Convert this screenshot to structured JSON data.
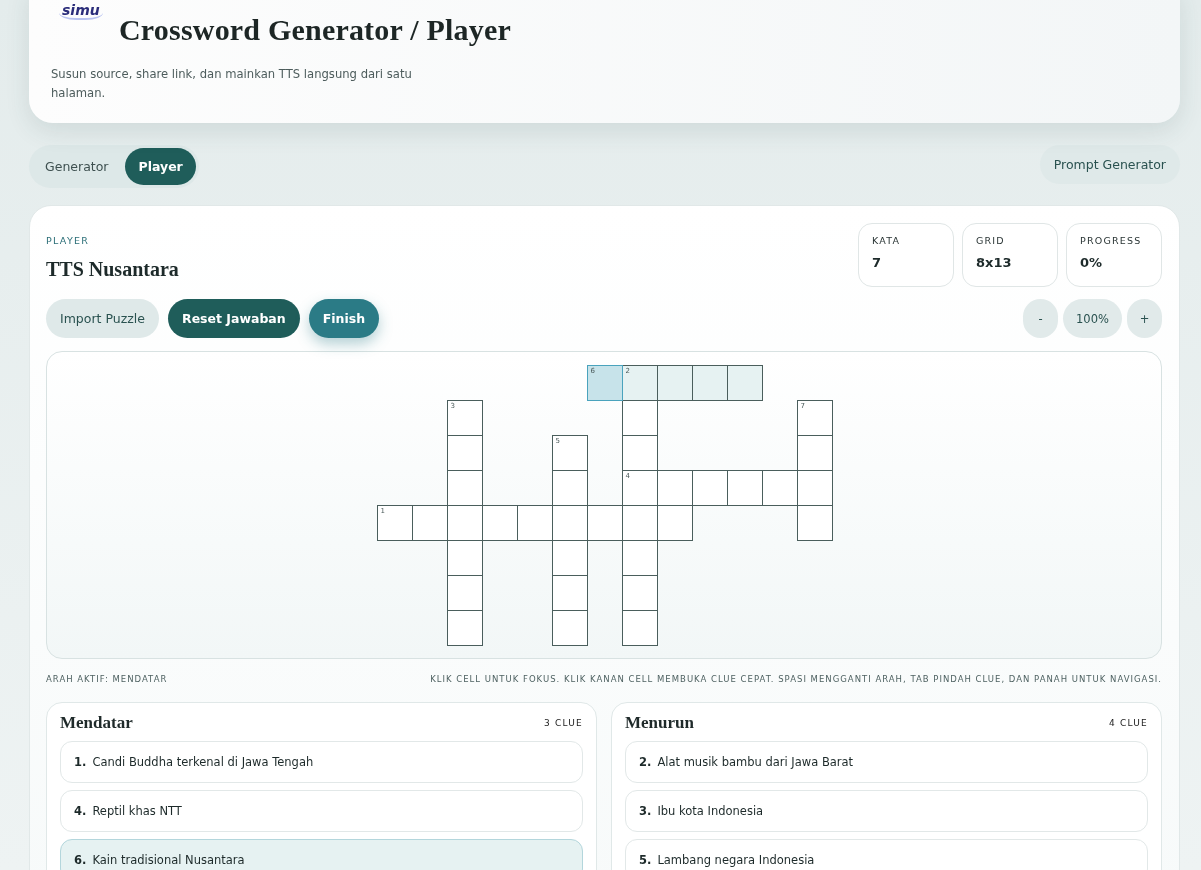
{
  "header": {
    "logo": "simu",
    "title": "Crossword Generator / Player",
    "subtitle": "Susun source, share link, dan mainkan TTS langsung dari satu halaman."
  },
  "mode_tabs": [
    {
      "label": "Generator",
      "selected": false
    },
    {
      "label": "Player",
      "selected": true
    }
  ],
  "prompt_button": "Prompt Generator",
  "player": {
    "eyebrow": "PLAYER",
    "title": "TTS Nusantara",
    "stats": [
      {
        "label": "KATA",
        "value": "7"
      },
      {
        "label": "GRID",
        "value": "8x13"
      },
      {
        "label": "PROGRESS",
        "value": "0%"
      }
    ],
    "actions": [
      {
        "label": "Import Puzzle",
        "kind": "light"
      },
      {
        "label": "Reset Jawaban",
        "kind": "dark"
      },
      {
        "label": "Finish",
        "kind": "accent"
      }
    ],
    "zoom": {
      "minus": "-",
      "value": "100%",
      "plus": "+"
    },
    "grid": {
      "rows": [
        {
          "cells": [
            {
              "kind": "block"
            },
            {
              "kind": "block"
            },
            {
              "kind": "block"
            },
            {
              "kind": "block"
            },
            {
              "kind": "block"
            },
            {
              "kind": "block"
            },
            {
              "kind": "cell",
              "number": "6",
              "focused": true,
              "highlighted": true
            },
            {
              "kind": "cell",
              "number": "2",
              "focused": false,
              "highlighted": true
            },
            {
              "kind": "cell",
              "focused": false,
              "highlighted": true
            },
            {
              "kind": "cell",
              "focused": false,
              "highlighted": true
            },
            {
              "kind": "cell",
              "focused": false,
              "highlighted": true
            },
            {
              "kind": "block"
            },
            {
              "kind": "block"
            }
          ]
        },
        {
          "cells": [
            {
              "kind": "block"
            },
            {
              "kind": "block"
            },
            {
              "kind": "cell",
              "number": "3"
            },
            {
              "kind": "block"
            },
            {
              "kind": "block"
            },
            {
              "kind": "block"
            },
            {
              "kind": "block"
            },
            {
              "kind": "cell"
            },
            {
              "kind": "block"
            },
            {
              "kind": "block"
            },
            {
              "kind": "block"
            },
            {
              "kind": "block"
            },
            {
              "kind": "cell",
              "number": "7"
            }
          ]
        },
        {
          "cells": [
            {
              "kind": "block"
            },
            {
              "kind": "block"
            },
            {
              "kind": "cell"
            },
            {
              "kind": "block"
            },
            {
              "kind": "block"
            },
            {
              "kind": "cell",
              "number": "5"
            },
            {
              "kind": "block"
            },
            {
              "kind": "cell"
            },
            {
              "kind": "block"
            },
            {
              "kind": "block"
            },
            {
              "kind": "block"
            },
            {
              "kind": "block"
            },
            {
              "kind": "cell"
            }
          ]
        },
        {
          "cells": [
            {
              "kind": "block"
            },
            {
              "kind": "block"
            },
            {
              "kind": "cell"
            },
            {
              "kind": "block"
            },
            {
              "kind": "block"
            },
            {
              "kind": "cell"
            },
            {
              "kind": "block"
            },
            {
              "kind": "cell",
              "number": "4"
            },
            {
              "kind": "cell"
            },
            {
              "kind": "cell"
            },
            {
              "kind": "cell"
            },
            {
              "kind": "cell"
            },
            {
              "kind": "cell"
            }
          ]
        },
        {
          "cells": [
            {
              "kind": "cell",
              "number": "1"
            },
            {
              "kind": "cell"
            },
            {
              "kind": "cell"
            },
            {
              "kind": "cell"
            },
            {
              "kind": "cell"
            },
            {
              "kind": "cell"
            },
            {
              "kind": "cell"
            },
            {
              "kind": "cell"
            },
            {
              "kind": "cell"
            },
            {
              "kind": "block"
            },
            {
              "kind": "block"
            },
            {
              "kind": "block"
            },
            {
              "kind": "cell"
            }
          ]
        },
        {
          "cells": [
            {
              "kind": "block"
            },
            {
              "kind": "block"
            },
            {
              "kind": "cell"
            },
            {
              "kind": "block"
            },
            {
              "kind": "block"
            },
            {
              "kind": "cell"
            },
            {
              "kind": "block"
            },
            {
              "kind": "cell"
            },
            {
              "kind": "block"
            },
            {
              "kind": "block"
            },
            {
              "kind": "block"
            },
            {
              "kind": "block"
            },
            {
              "kind": "block"
            }
          ]
        },
        {
          "cells": [
            {
              "kind": "block"
            },
            {
              "kind": "block"
            },
            {
              "kind": "cell"
            },
            {
              "kind": "block"
            },
            {
              "kind": "block"
            },
            {
              "kind": "cell"
            },
            {
              "kind": "block"
            },
            {
              "kind": "cell"
            },
            {
              "kind": "block"
            },
            {
              "kind": "block"
            },
            {
              "kind": "block"
            },
            {
              "kind": "block"
            },
            {
              "kind": "block"
            }
          ]
        },
        {
          "cells": [
            {
              "kind": "block"
            },
            {
              "kind": "block"
            },
            {
              "kind": "cell"
            },
            {
              "kind": "block"
            },
            {
              "kind": "block"
            },
            {
              "kind": "cell"
            },
            {
              "kind": "block"
            },
            {
              "kind": "cell"
            },
            {
              "kind": "block"
            },
            {
              "kind": "block"
            },
            {
              "kind": "block"
            },
            {
              "kind": "block"
            },
            {
              "kind": "block"
            }
          ]
        }
      ]
    },
    "direction_status": "ARAH AKTIF: MENDATAR",
    "help": "KLIK CELL UNTUK FOKUS. KLIK KANAN CELL MEMBUKA CLUE CEPAT. SPASI MENGGANTI ARAH, TAB PINDAH CLUE, DAN PANAH UNTUK NAVIGASI.",
    "clue_lists": [
      {
        "title": "Mendatar",
        "count": "3 CLUE",
        "clues": [
          {
            "number": "1.",
            "text": "Candi Buddha terkenal di Jawa Tengah",
            "selected": false
          },
          {
            "number": "4.",
            "text": "Reptil khas NTT",
            "selected": false
          },
          {
            "number": "6.",
            "text": "Kain tradisional Nusantara",
            "selected": true
          }
        ]
      },
      {
        "title": "Menurun",
        "count": "4 CLUE",
        "clues": [
          {
            "number": "2.",
            "text": "Alat musik bambu dari Jawa Barat",
            "selected": false
          },
          {
            "number": "3.",
            "text": "Ibu kota Indonesia",
            "selected": false
          },
          {
            "number": "5.",
            "text": "Lambang negara Indonesia",
            "selected": false
          }
        ]
      }
    ]
  }
}
